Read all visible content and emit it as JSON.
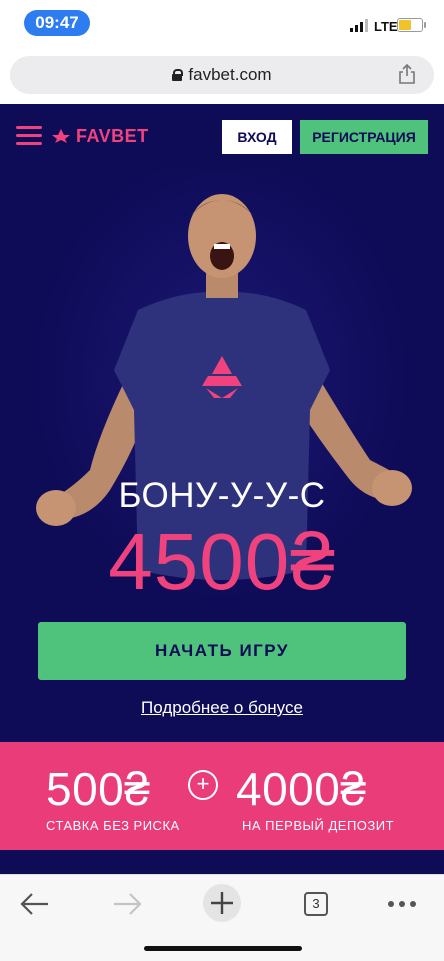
{
  "status_bar": {
    "time": "09:47",
    "network": "LTE",
    "battery_level": 0.6
  },
  "browser": {
    "url": "favbet.com"
  },
  "site": {
    "brand": "FAVBET",
    "login_label": "ВХОД",
    "register_label": "РЕГИСТРАЦИЯ",
    "bonus_word": "БОНУ-У-У-С",
    "bonus_amount": "4500₴",
    "start_button": "НАЧАТЬ ИГРУ",
    "more_link": "Подробнее о бонусе",
    "promo": {
      "left_amount": "500₴",
      "left_caption": "СТАВКА БЕЗ РИСКА",
      "plus": "+",
      "right_amount": "4000₴",
      "right_caption": "НА ПЕРВЫЙ ДЕПОЗИТ"
    }
  },
  "toolbar": {
    "tab_count": "3"
  },
  "colors": {
    "site_bg": "#0e0b57",
    "brand_pink": "#f0437d",
    "green": "#4fc37c",
    "promo_bg": "#e93c78"
  }
}
